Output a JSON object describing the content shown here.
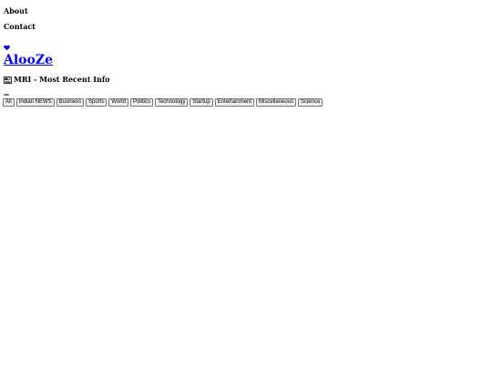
{
  "nav": {
    "about": "About",
    "contact": "Contact"
  },
  "icons": {
    "heart": "heart-icon",
    "newspaper": "newspaper-icon"
  },
  "colors": {
    "link": "#0000ee",
    "heart": "#0000cc",
    "button_bg": "#efefef",
    "button_border": "#767676"
  },
  "brand": {
    "name": "AlooZe"
  },
  "tagline": {
    "text": "MRI - Most Recent Info"
  },
  "filters": [
    {
      "label": "All"
    },
    {
      "label": "Indian NEWS"
    },
    {
      "label": "Business"
    },
    {
      "label": "Sports"
    },
    {
      "label": "World"
    },
    {
      "label": "Politics"
    },
    {
      "label": "Technology"
    },
    {
      "label": "Startup"
    },
    {
      "label": "Entertainment"
    },
    {
      "label": "Miscellaneous"
    },
    {
      "label": "Science"
    }
  ]
}
